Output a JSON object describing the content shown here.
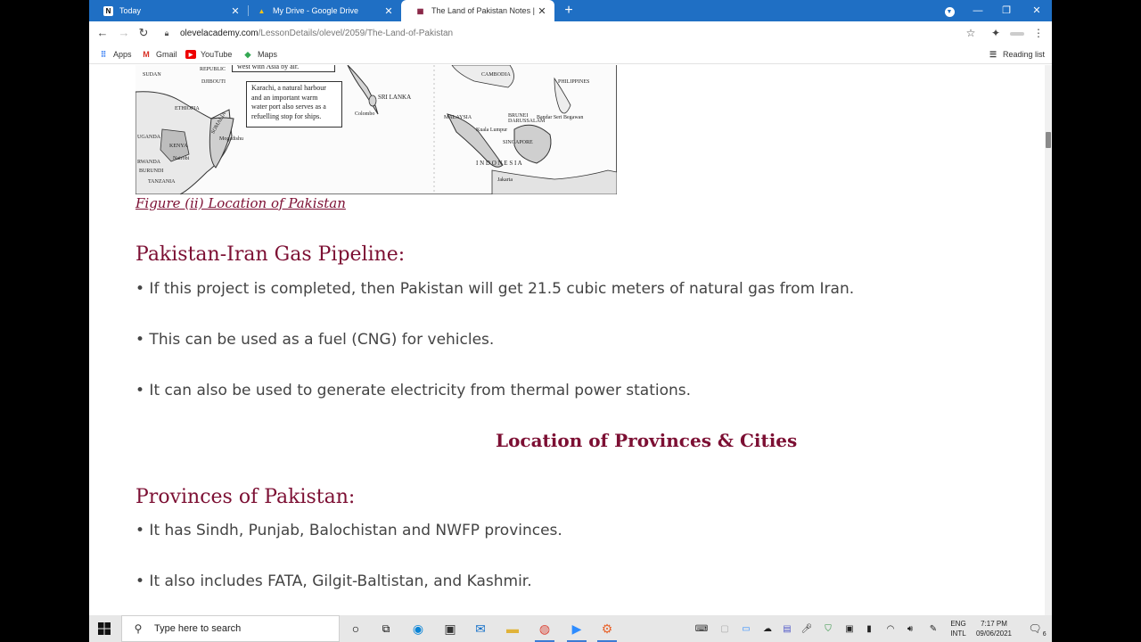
{
  "tabs": [
    {
      "title": "Today",
      "icon": "notion-icon",
      "icon_glyph": "N",
      "active": false
    },
    {
      "title": "My Drive - Google Drive",
      "icon": "google-drive-icon",
      "icon_glyph": "▲",
      "active": false
    },
    {
      "title": "The Land of Pakistan Notes | Pakistan",
      "icon": "olevel-academy-icon",
      "icon_glyph": "▦",
      "active": true
    }
  ],
  "toolbar": {
    "url_host": "olevelacademy.com",
    "url_path": "/LessonDetails/olevel/2059/The-Land-of-Pakistan"
  },
  "bookmarks": [
    {
      "label": "Apps",
      "icon": "apps-grid-icon"
    },
    {
      "label": "Gmail",
      "icon": "gmail-icon"
    },
    {
      "label": "YouTube",
      "icon": "youtube-icon"
    },
    {
      "label": "Maps",
      "icon": "maps-icon"
    }
  ],
  "reading_list": "Reading list",
  "map": {
    "labels": [
      "SUDAN",
      "DJIBOUTI",
      "ETHIOPIA",
      "UGANDA",
      "KENYA",
      "Nairobi",
      "RWANDA",
      "BURUNDI",
      "TANZANIA",
      "SOMALIA",
      "Mogadishu",
      "REPUBLIC",
      "SRI LANKA",
      "Colombo",
      "CAMBODIA",
      "PHILIPPINES",
      "MALAYSIA",
      "Kuala Lumpur",
      "BRUNEI DARUSSALAM",
      "Bandar Seri Begawan",
      "SINGAPORE",
      "I N D O N E S I A",
      "Jakarta"
    ],
    "callout_top": "west with Asia by air.",
    "callout_main": "Karachi, a natural harbour\nand an important warm\nwater port also serves as a\nrefuelling stop for ships."
  },
  "content": {
    "figure_caption": "Figure (ii) Location of Pakistan",
    "section1_heading": "Pakistan-Iran Gas Pipeline:",
    "section1_bullets": [
      "• If this project is completed, then Pakistan will get 21.5 cubic meters of natural gas from Iran.",
      "• This can be used as a fuel (CNG) for vehicles.",
      "• It can also be used to generate electricity from thermal power stations."
    ],
    "center_heading": "Location of Provinces & Cities",
    "section2_heading": "Provinces of Pakistan:",
    "section2_bullets": [
      "• It has Sindh, Punjab, Balochistan and NWFP provinces.",
      "• It also includes FATA, Gilgit-Baltistan, and Kashmir."
    ]
  },
  "taskbar": {
    "search_placeholder": "Type here to search",
    "language_top": "ENG",
    "language_bottom": "INTL",
    "time": "7:17 PM",
    "date": "09/06/2021",
    "notification_count": "6"
  },
  "colors": {
    "accent_maroon": "#7c0f33",
    "tabstrip_blue": "#1f6fc4",
    "body_text": "#444444"
  }
}
